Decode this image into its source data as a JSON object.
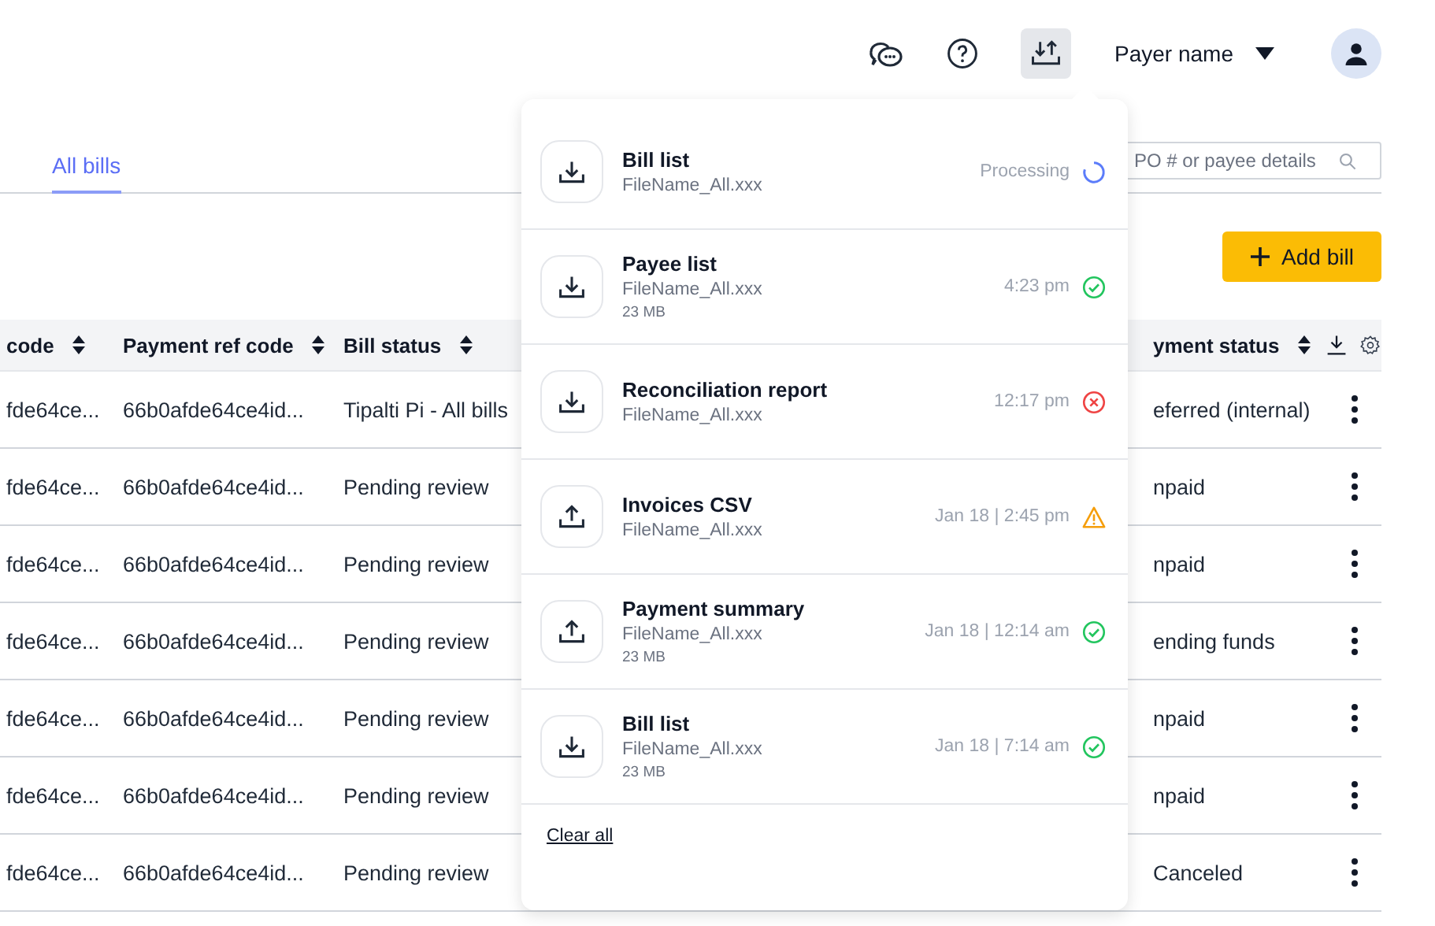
{
  "header": {
    "uploads_active": true,
    "user_name": "Payer name"
  },
  "tabs": [
    {
      "label": "All bills",
      "selected": true
    }
  ],
  "search": {
    "placeholder": "PO # or payee details"
  },
  "add_button": "Add bill",
  "table": {
    "columns": [
      "code",
      "Payment ref code",
      "Bill status",
      "yment status"
    ],
    "rows": [
      {
        "cells": [
          "fde64ce...",
          "66b0afde64ce4id...",
          "Tipalti Pi - All bills",
          "eferred (internal)"
        ]
      },
      {
        "cells": [
          "fde64ce...",
          "66b0afde64ce4id...",
          "Pending review",
          "npaid"
        ]
      },
      {
        "cells": [
          "fde64ce...",
          "66b0afde64ce4id...",
          "Pending review",
          "npaid"
        ]
      },
      {
        "cells": [
          "fde64ce...",
          "66b0afde64ce4id...",
          "Pending review",
          "ending funds"
        ]
      },
      {
        "cells": [
          "fde64ce...",
          "66b0afde64ce4id...",
          "Pending review",
          "npaid"
        ]
      },
      {
        "cells": [
          "fde64ce...",
          "66b0afde64ce4id...",
          "Pending review",
          "npaid"
        ]
      },
      {
        "cells": [
          "fde64ce...",
          "66b0afde64ce4id...",
          "Pending review",
          "Canceled"
        ]
      }
    ]
  },
  "downloads": {
    "items": [
      {
        "kind": "download",
        "title": "Bill list",
        "filename": "FileName_All.xxx",
        "time": "Processing",
        "status": {
          "kind": "processing"
        }
      },
      {
        "kind": "download",
        "title": "Payee list",
        "filename": "FileName_All.xxx",
        "size": "23 MB",
        "time": "4:23 pm",
        "status": {
          "kind": "success"
        }
      },
      {
        "kind": "download",
        "title": "Reconciliation report",
        "filename": "FileName_All.xxx",
        "time": "12:17 pm",
        "status": {
          "kind": "error"
        }
      },
      {
        "kind": "upload",
        "title": "Invoices CSV",
        "filename": "FileName_All.xxx",
        "time": "Jan 18 | 2:45 pm",
        "status": {
          "kind": "warning"
        }
      },
      {
        "kind": "upload",
        "title": "Payment summary",
        "filename": "FileName_All.xxx",
        "size": "23 MB",
        "time": "Jan 18 | 12:14 am",
        "status": {
          "kind": "success"
        }
      },
      {
        "kind": "download",
        "title": "Bill list",
        "filename": "FileName_All.xxx",
        "size": "23 MB",
        "time": "Jan 18 | 7:14 am",
        "status": {
          "kind": "success"
        }
      }
    ],
    "clear_label": "Clear all"
  }
}
